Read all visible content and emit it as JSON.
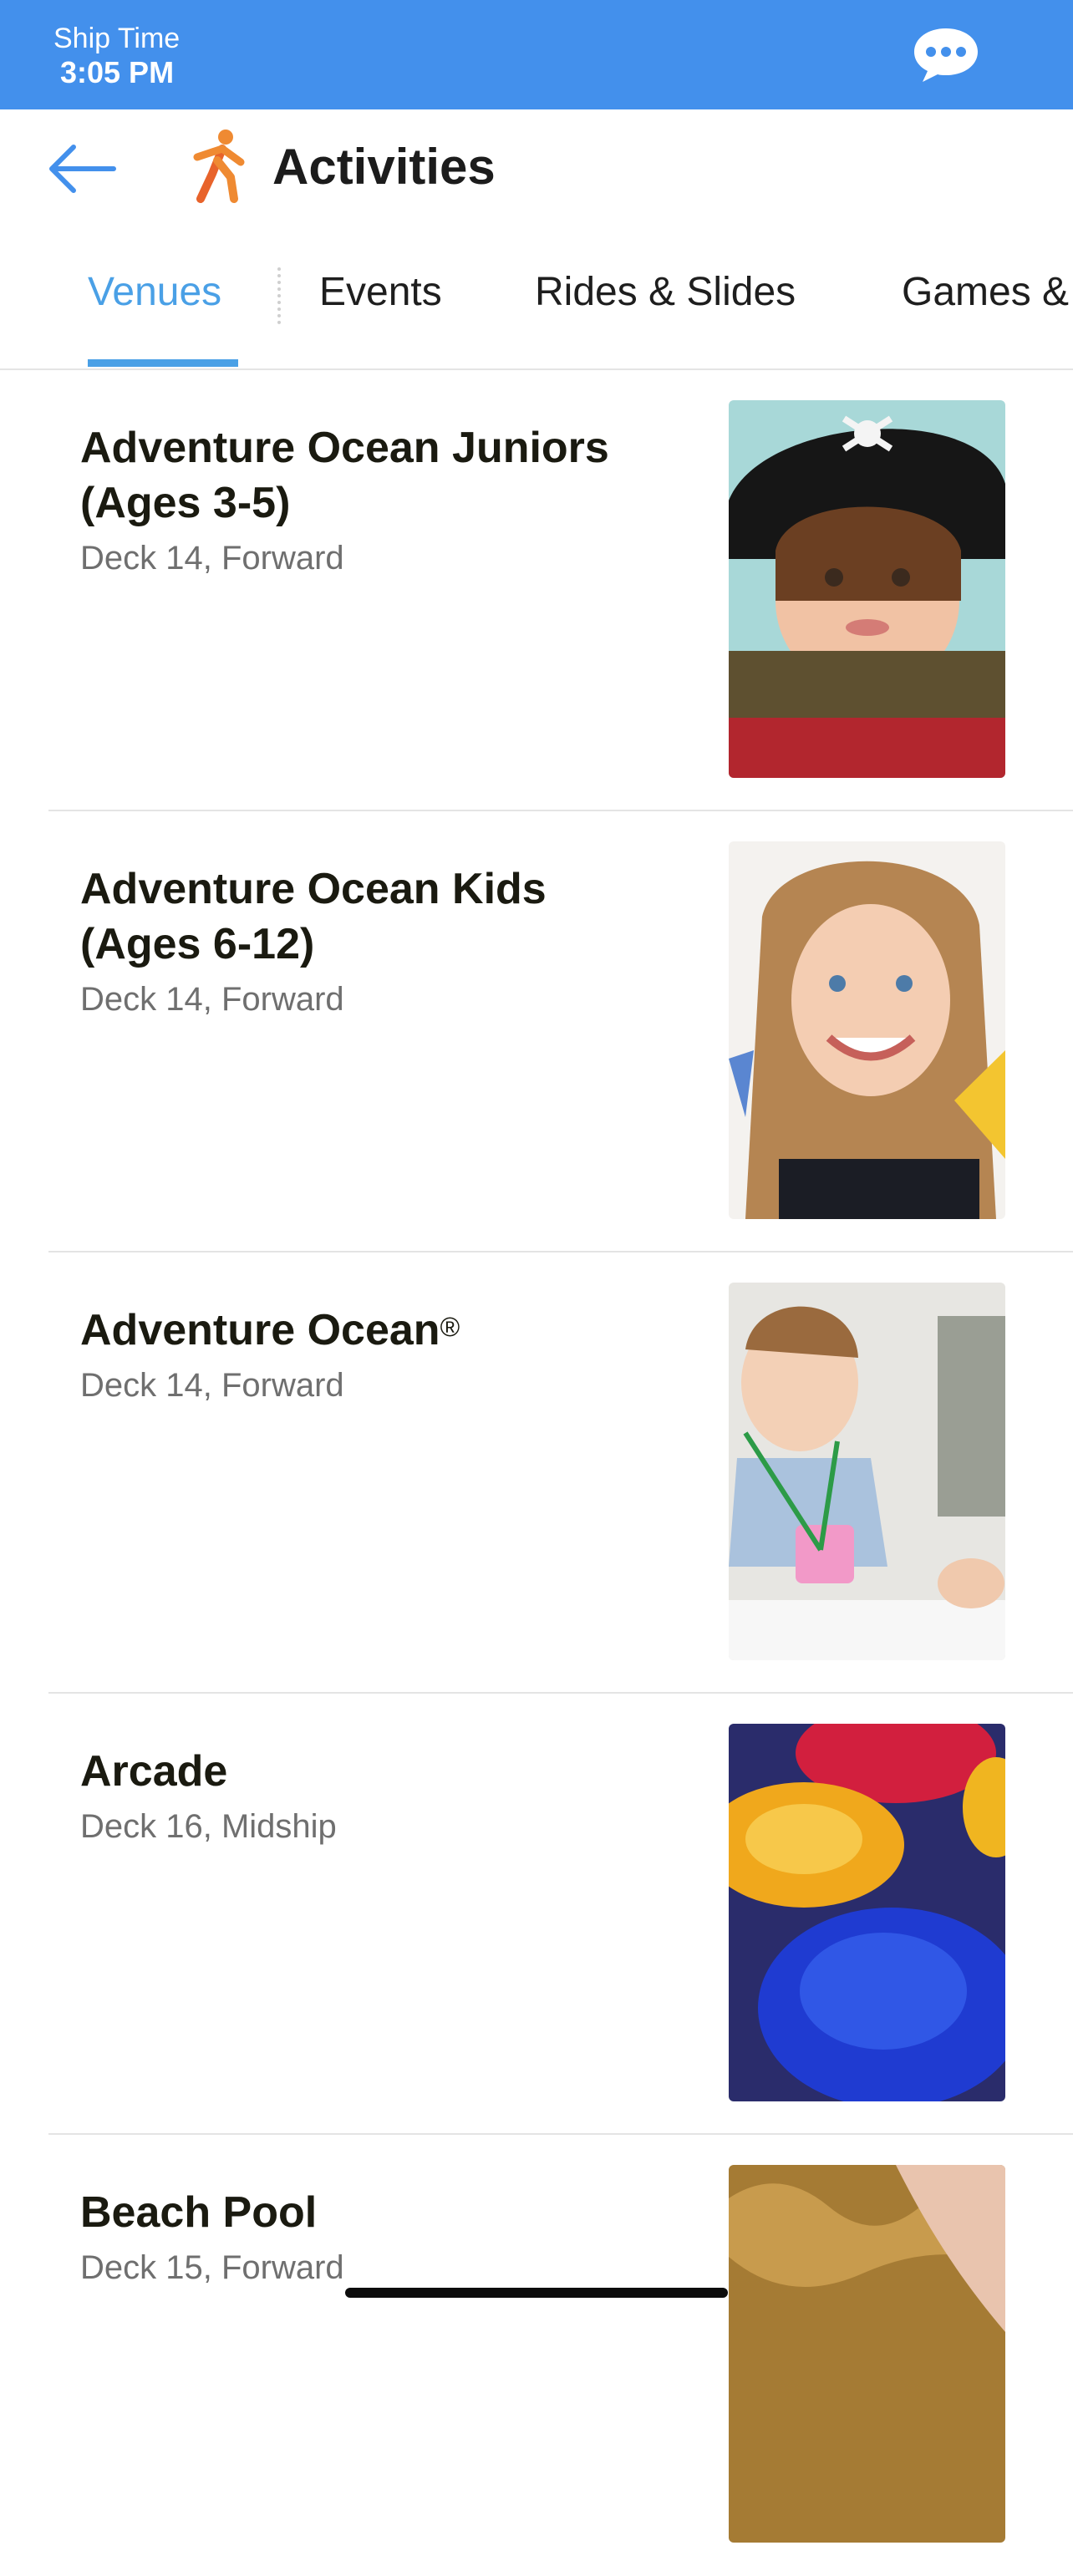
{
  "status_bar": {
    "ship_time_label": "Ship Time",
    "ship_time_value": "3:05 PM",
    "chat_icon": "chat-bubble-icon",
    "color": "#4390ec"
  },
  "header": {
    "back_icon": "back-arrow-icon",
    "title_icon": "running-person-icon",
    "title": "Activities"
  },
  "tabs": [
    {
      "label": "Venues",
      "active": true
    },
    {
      "label": "Events",
      "active": false
    },
    {
      "label": "Rides & Slides",
      "active": false
    },
    {
      "label": "Games &",
      "active": false
    }
  ],
  "venues": [
    {
      "title_line1": "Adventure Ocean Juniors",
      "title_line2": "(Ages 3-5)",
      "location": "Deck 14, Forward"
    },
    {
      "title_line1": "Adventure Ocean Kids",
      "title_line2": "(Ages 6-12)",
      "location": "Deck 14, Forward"
    },
    {
      "title_line1": "Adventure Ocean",
      "title_mark": "®",
      "location": "Deck 14, Forward"
    },
    {
      "title_line1": "Arcade",
      "location": "Deck 16, Midship"
    },
    {
      "title_line1": "Beach Pool",
      "location": "Deck 15, Forward"
    }
  ],
  "accent_color": "#4aa0e6"
}
